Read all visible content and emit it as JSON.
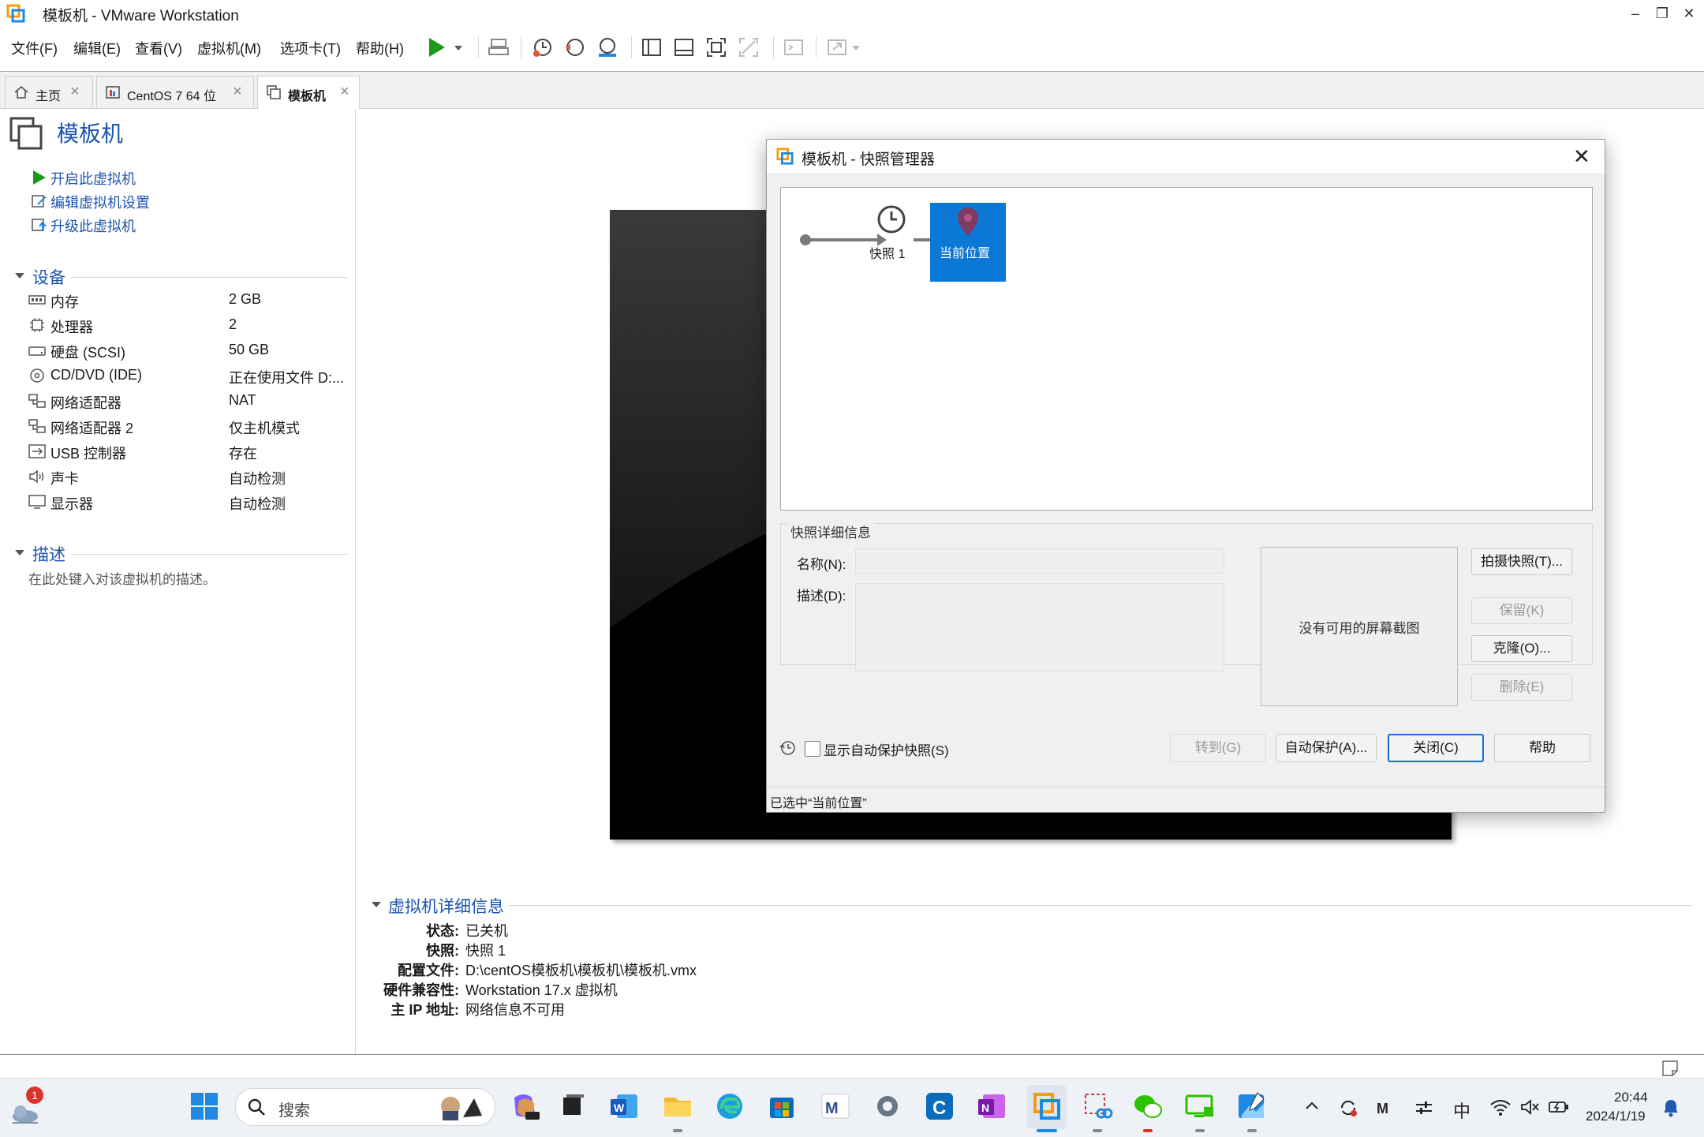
{
  "window": {
    "title": "模板机 - VMware Workstation",
    "controls": [
      "–",
      "❐",
      "✕"
    ]
  },
  "menu": [
    "文件(F)",
    "编辑(E)",
    "查看(V)",
    "虚拟机(M)",
    "选项卡(T)",
    "帮助(H)"
  ],
  "tabs": [
    {
      "label": "主页",
      "icon": "home-icon",
      "active": false
    },
    {
      "label": "CentOS 7 64 位",
      "icon": "vm-icon",
      "active": false
    },
    {
      "label": "模板机",
      "icon": "vm-page-icon",
      "active": true
    }
  ],
  "vm": {
    "title": "模板机",
    "actions": [
      "开启此虚拟机",
      "编辑虚拟机设置",
      "升级此虚拟机"
    ],
    "devices_heading": "设备",
    "devices": [
      {
        "name": "内存",
        "value": "2 GB",
        "icon": "memory-icon"
      },
      {
        "name": "处理器",
        "value": "2",
        "icon": "cpu-icon"
      },
      {
        "name": "硬盘 (SCSI)",
        "value": "50 GB",
        "icon": "disk-icon"
      },
      {
        "name": "CD/DVD (IDE)",
        "value": "正在使用文件 D:...",
        "icon": "cdrom-icon"
      },
      {
        "name": "网络适配器",
        "value": "NAT",
        "icon": "network-icon"
      },
      {
        "name": "网络适配器 2",
        "value": "仅主机模式",
        "icon": "network-icon"
      },
      {
        "name": "USB 控制器",
        "value": "存在",
        "icon": "usb-icon"
      },
      {
        "name": "声卡",
        "value": "自动检测",
        "icon": "sound-icon"
      },
      {
        "name": "显示器",
        "value": "自动检测",
        "icon": "monitor-icon"
      }
    ],
    "description_heading": "描述",
    "description_placeholder": "在此处键入对该虚拟机的描述。",
    "details_heading": "虚拟机详细信息",
    "details": [
      {
        "label": "状态:",
        "value": "已关机"
      },
      {
        "label": "快照:",
        "value": "快照 1"
      },
      {
        "label": "配置文件:",
        "value": "D:\\centOS模板机\\模板机\\模板机.vmx"
      },
      {
        "label": "硬件兼容性:",
        "value": "Workstation 17.x 虚拟机"
      },
      {
        "label": "主 IP 地址:",
        "value": "网络信息不可用"
      }
    ]
  },
  "dialog": {
    "title": "模板机 - 快照管理器",
    "snapshot_node": "快照 1",
    "current_node": "当前位置",
    "details_group": "快照详细信息",
    "name_label": "名称(N):",
    "desc_label": "描述(D):",
    "no_screenshot": "没有可用的屏幕截图",
    "buttons": {
      "take": "拍摄快照(T)...",
      "keep": "保留(K)",
      "clone": "克隆(O)...",
      "delete": "删除(E)",
      "goto": "转到(G)",
      "autoprotect": "自动保护(A)...",
      "close": "关闭(C)",
      "help": "帮助"
    },
    "show_autoprotect": "显示自动保护快照(S)",
    "status": "已选中“当前位置”"
  },
  "taskbar": {
    "notification_count": "1",
    "search_placeholder": "搜索",
    "tray_ime": "中",
    "time": "20:44",
    "date": "2024/1/19"
  },
  "colors": {
    "accent": "#1b55b0",
    "selection": "#0b78d6",
    "play": "#1a9a1a"
  }
}
